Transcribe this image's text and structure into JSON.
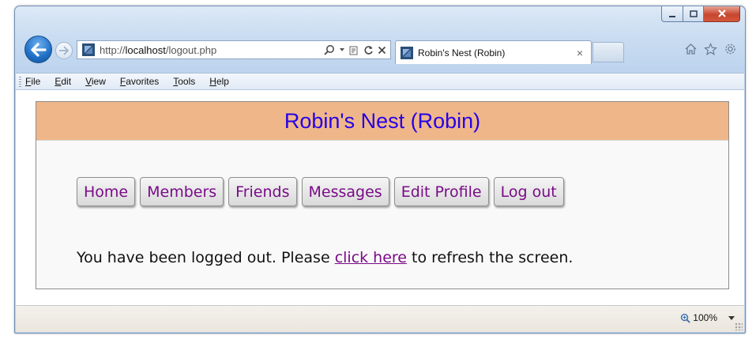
{
  "browser": {
    "address": {
      "prefix": "http://",
      "host": "localhost",
      "path": "/logout.php"
    },
    "tab": {
      "title": "Robin's Nest (Robin)",
      "close": "×"
    },
    "menu": [
      "File",
      "Edit",
      "View",
      "Favorites",
      "Tools",
      "Help"
    ],
    "zoom": "100%"
  },
  "site": {
    "title": "Robin's Nest (Robin)",
    "nav": [
      {
        "label": "Home"
      },
      {
        "label": "Members"
      },
      {
        "label": "Friends"
      },
      {
        "label": "Messages"
      },
      {
        "label": "Edit Profile"
      },
      {
        "label": "Log out"
      }
    ],
    "message": {
      "before": "You have been logged out. Please ",
      "link": "click here",
      "after": " to refresh the screen."
    }
  },
  "colors": {
    "header_bg": "#efb789",
    "title_color": "#2600e8",
    "link_color": "#790b87"
  }
}
